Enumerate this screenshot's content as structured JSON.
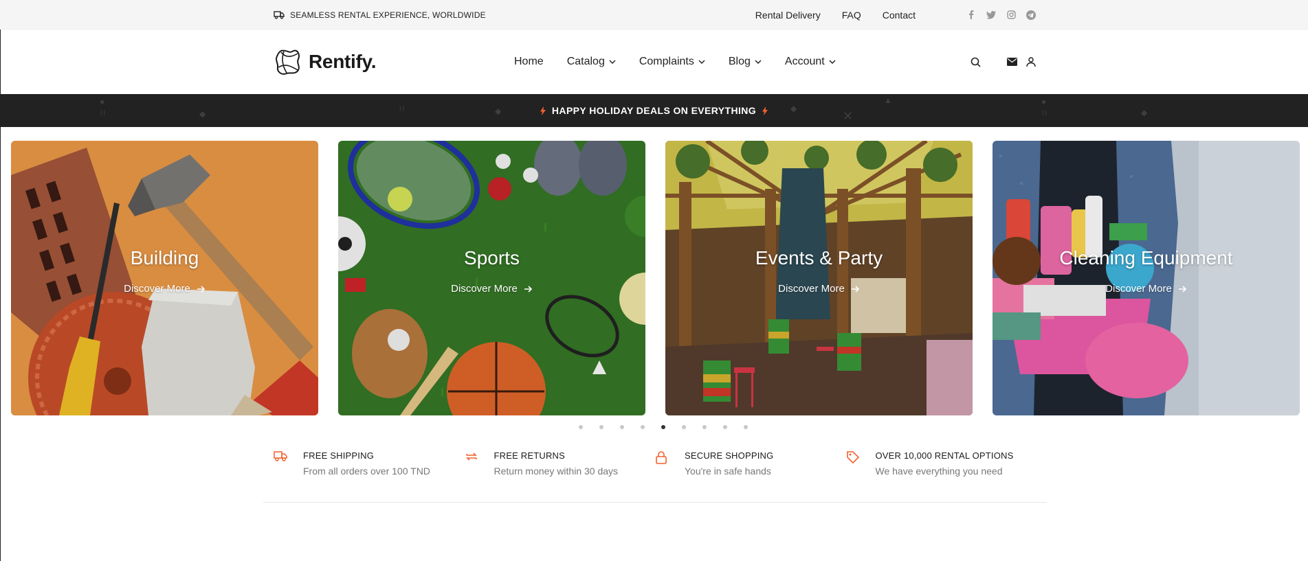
{
  "topbar": {
    "promo_text": "SEAMLESS RENTAL EXPERIENCE, WORLDWIDE",
    "links": [
      "Rental Delivery",
      "FAQ",
      "Contact"
    ],
    "social_icons": [
      "facebook-icon",
      "twitter-icon",
      "instagram-icon",
      "telegram-icon"
    ]
  },
  "header": {
    "brand": "Rentify.",
    "nav": {
      "home": "Home",
      "catalog": "Catalog",
      "complaints": "Complaints",
      "blog": "Blog",
      "account": "Account"
    },
    "icons": [
      "search-icon",
      "envelope-icon",
      "user-icon"
    ]
  },
  "announcement": {
    "text": "HAPPY HOLIDAY DEALS ON EVERYTHING",
    "icon": "lightning-icon",
    "accent": "#f0612d"
  },
  "slides": [
    {
      "title": "Building",
      "cta": "Discover More"
    },
    {
      "title": "Sports",
      "cta": "Discover More"
    },
    {
      "title": "Events & Party",
      "cta": "Discover More"
    },
    {
      "title": "Cleaning Equipment",
      "cta": "Discover More"
    }
  ],
  "pagination": {
    "count": 9,
    "active": 5
  },
  "features": [
    {
      "icon": "truck-icon",
      "title": "FREE SHIPPING",
      "subtitle": "From all orders over 100 TND"
    },
    {
      "icon": "returns-icon",
      "title": "FREE RETURNS",
      "subtitle": "Return money within 30 days"
    },
    {
      "icon": "lock-icon",
      "title": "SECURE SHOPPING",
      "subtitle": "You're in safe hands"
    },
    {
      "icon": "tag-icon",
      "title": "OVER 10,000 RENTAL OPTIONS",
      "subtitle": "We have everything you need"
    }
  ],
  "colors": {
    "accent": "#f0612d",
    "dark": "#222222",
    "topbar_bg": "#f5f5f5"
  }
}
